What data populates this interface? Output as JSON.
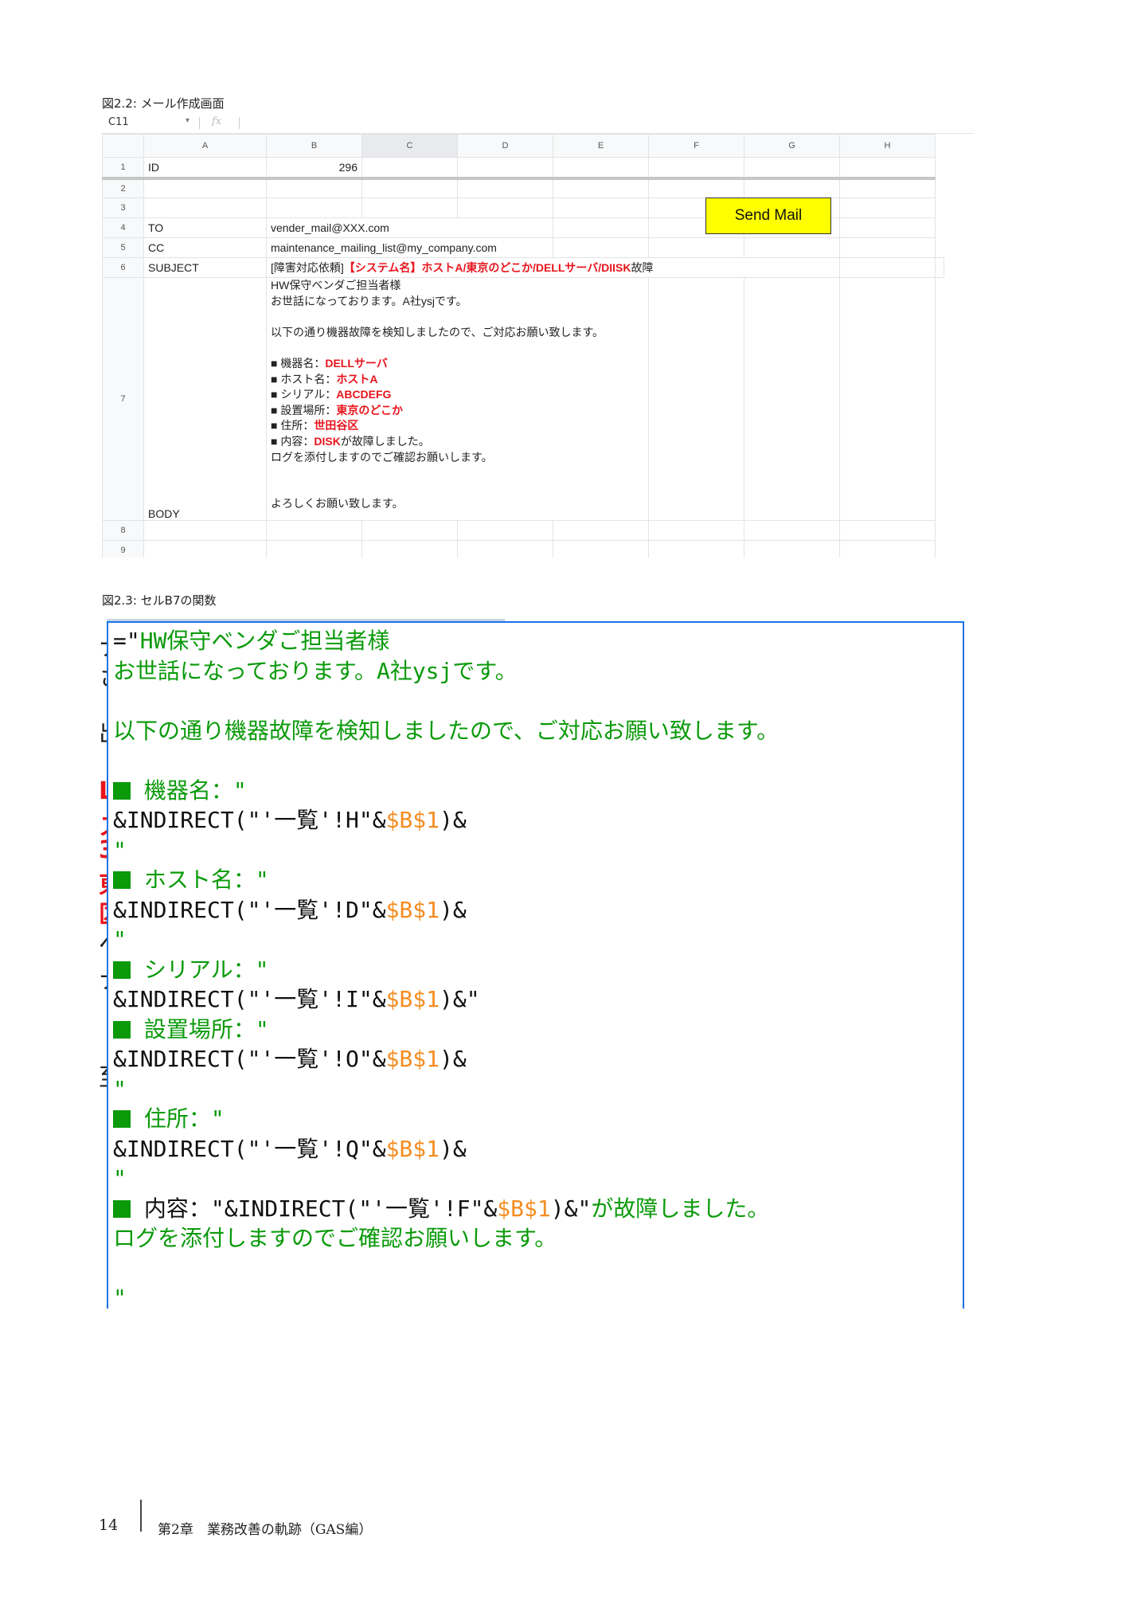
{
  "figure1": {
    "caption": "図2.2: メール作成画面",
    "formula_bar": {
      "cell_ref": "C11",
      "fx": "fx"
    },
    "columns": [
      "A",
      "B",
      "C",
      "D",
      "E",
      "F",
      "G",
      "H"
    ],
    "rows": {
      "r1": {
        "num": "1",
        "a": "ID",
        "b": "296"
      },
      "r2": {
        "num": "2"
      },
      "r3": {
        "num": "3"
      },
      "r4": {
        "num": "4",
        "a": "TO",
        "b": "vender_mail@XXX.com"
      },
      "r5": {
        "num": "5",
        "a": "CC",
        "b": "maintenance_mailing_list@my_company.com"
      },
      "r6": {
        "num": "6",
        "a": "SUBJECT",
        "b_prefix": "[障害対応依頼]",
        "b_red": "【システム名】ホストA/東京のどこか/DELLサーバ/DIISK",
        "b_suffix": "故障"
      },
      "r7": {
        "num": "7",
        "a": "BODY",
        "body": {
          "greeting1": "HW保守ベンダご担当者様",
          "greeting2": "お世話になっております。A社ysjです。",
          "intro": "以下の通り機器故障を検知しましたので、ご対応お願い致します。",
          "items": [
            {
              "label": "■ 機器名：",
              "value": "DELLサーバ"
            },
            {
              "label": "■ ホスト名：",
              "value": "ホストA"
            },
            {
              "label": "■ シリアル：",
              "value": "ABCDEFG"
            },
            {
              "label": "■ 設置場所：",
              "value": "東京のどこか"
            },
            {
              "label": "■ 住所：",
              "value": "世田谷区"
            },
            {
              "label": "■ 内容：",
              "value": "DISK",
              "suffix": "が故障しました。"
            }
          ],
          "log_line": "ログを添付しますのでご確認お願いします。",
          "closing": "よろしくお願い致します。"
        }
      },
      "r8": {
        "num": "8"
      },
      "r9": {
        "num": "9"
      }
    },
    "send_button": "Send Mail"
  },
  "figure2": {
    "caption": "図2.3: セルB7の関数",
    "background_fragments": [
      "ナ",
      "さ",
      "出",
      "L",
      "ス",
      "3",
      "東",
      "区",
      "ペ",
      "ナ",
      "至"
    ],
    "formula": {
      "l1_prefix": "=\"",
      "l1_text": "HW保守ベンダご担当者様",
      "l2": "お世話になっております。A社ysjです。",
      "l4": "以下の通り機器故障を検知しましたので、ご対応お願い致します。",
      "item1_label": " 機器名：\"",
      "item1_pre": "&INDIRECT(\"'一覧'!H\"&",
      "item1_ref": "$B$1",
      "item1_post": ")&",
      "item1_q": "\"",
      "item2_label": " ホスト名：\"",
      "item2_pre": "&INDIRECT(\"'一覧'!D\"&",
      "item2_ref": "$B$1",
      "item2_post": ")&",
      "item2_q": "\"",
      "item3_label": " シリアル：\"",
      "item3_pre": "&INDIRECT(\"'一覧'!I\"&",
      "item3_ref": "$B$1",
      "item3_post": ")&\"",
      "item4_label": " 設置場所：\"",
      "item4_pre": "&INDIRECT(\"'一覧'!O\"&",
      "item4_ref": "$B$1",
      "item4_post": ")&",
      "item4_q": "\"",
      "item5_label": " 住所：\"",
      "item5_pre": "&INDIRECT(\"'一覧'!Q\"&",
      "item5_ref": "$B$1",
      "item5_post": ")&",
      "item5_q": "\"",
      "item6_label": " 内容：\"&INDIRECT(\"'一覧'!F\"&",
      "item6_ref": "$B$1",
      "item6_post": ")&\"",
      "item6_tail": "が故障しました。",
      "log_line": "ログを添付しますのでご確認お願いします。",
      "end_q": "\""
    }
  },
  "footer": {
    "page_number": "14",
    "chapter": "第2章　業務改善の軌跡（GAS編）"
  }
}
